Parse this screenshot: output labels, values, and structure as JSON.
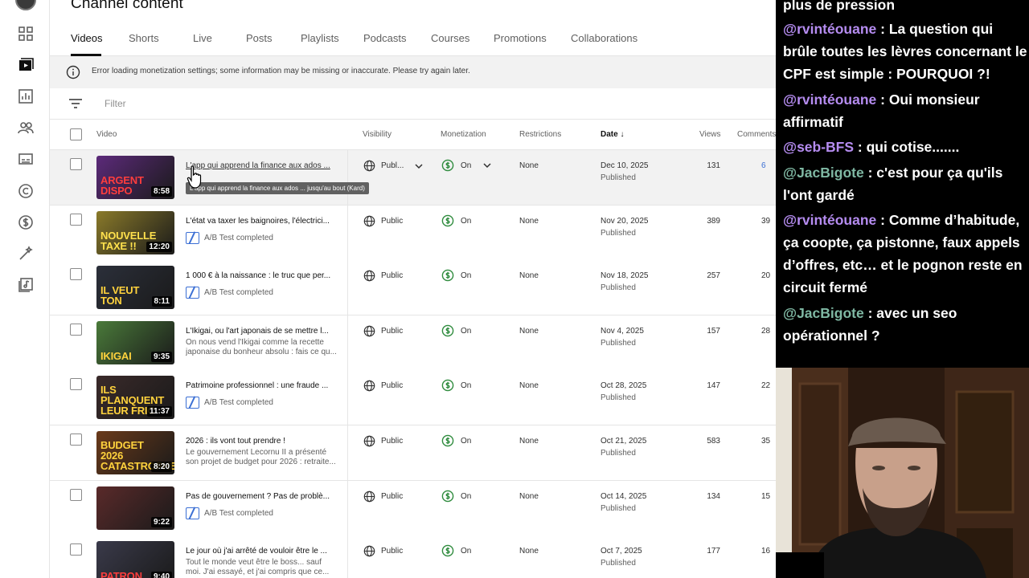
{
  "studio": {
    "page_title": "Channel content",
    "tabs": [
      "Videos",
      "Shorts",
      "Live",
      "Posts",
      "Playlists",
      "Podcasts",
      "Courses",
      "Promotions",
      "Collaborations"
    ],
    "active_tab": "Videos",
    "banner_text": "Error loading monetization settings; some information may be missing or inaccurate. Please try again later.",
    "filter_placeholder": "Filter",
    "columns": {
      "video": "Video",
      "visibility": "Visibility",
      "monetization": "Monetization",
      "restrictions": "Restrictions",
      "date": "Date",
      "views": "Views",
      "comments": "Comments"
    },
    "tooltip": "L'app qui apprend la finance aux ados ... jusqu'au bout (Kard)",
    "rows": [
      {
        "title": "L'app qui apprend la finance aux ados ...",
        "desc": "",
        "ab": "",
        "duration": "8:58",
        "thumb_text": "ARGENT DISPO",
        "thumb_bg": "#5c2a7a",
        "thumb_fg": "#ff3d3d",
        "visibility": "Publ...",
        "monetization": "On",
        "restrictions": "None",
        "date": "Dec 10, 2025",
        "status": "Published",
        "views": "131",
        "comments": "6"
      },
      {
        "title": "L'état va taxer les baignoires, l'électrici...",
        "desc": "",
        "ab": "A/B Test completed",
        "duration": "12:20",
        "thumb_text": "NOUVELLE TAXE !!",
        "thumb_bg": "#8a7a2a",
        "thumb_fg": "#ffe14d",
        "visibility": "Public",
        "monetization": "On",
        "restrictions": "None",
        "date": "Nov 20, 2025",
        "status": "Published",
        "views": "389",
        "comments": "39"
      },
      {
        "title": "1 000 € à la naissance : le truc que per...",
        "desc": "",
        "ab": "A/B Test completed",
        "duration": "8:11",
        "thumb_text": "IL VEUT TON",
        "thumb_bg": "#2b2f3a",
        "thumb_fg": "#ffd23d",
        "visibility": "Public",
        "monetization": "On",
        "restrictions": "None",
        "date": "Nov 18, 2025",
        "status": "Published",
        "views": "257",
        "comments": "20"
      },
      {
        "title": "L'Ikigai, ou l'art japonais de se mettre l...",
        "desc": "On nous vend l'Ikigai comme la recette japonaise du bonheur absolu : fais ce qu...",
        "ab": "",
        "duration": "9:35",
        "thumb_text": "IKIGAI",
        "thumb_bg": "#4a7a3a",
        "thumb_fg": "#ffd23d",
        "visibility": "Public",
        "monetization": "On",
        "restrictions": "None",
        "date": "Nov 4, 2025",
        "status": "Published",
        "views": "157",
        "comments": "28"
      },
      {
        "title": "Patrimoine professionnel : une fraude ...",
        "desc": "",
        "ab": "A/B Test completed",
        "duration": "11:37",
        "thumb_text": "ILS PLANQUENT LEUR FRIC",
        "thumb_bg": "#3a2a2a",
        "thumb_fg": "#ffd23d",
        "visibility": "Public",
        "monetization": "On",
        "restrictions": "None",
        "date": "Oct 28, 2025",
        "status": "Published",
        "views": "147",
        "comments": "22"
      },
      {
        "title": "2026 : ils vont tout prendre !",
        "desc": "Le gouvernement Lecornu II a présenté son projet de budget pour 2026 : retraite...",
        "ab": "",
        "duration": "8:20",
        "thumb_text": "BUDGET 2026 CATASTROPHE",
        "thumb_bg": "#6a3a1a",
        "thumb_fg": "#ffd23d",
        "visibility": "Public",
        "monetization": "On",
        "restrictions": "None",
        "date": "Oct 21, 2025",
        "status": "Published",
        "views": "583",
        "comments": "35"
      },
      {
        "title": "Pas de gouvernement ? Pas de problè...",
        "desc": "",
        "ab": "A/B Test completed",
        "duration": "9:22",
        "thumb_text": "",
        "thumb_bg": "#5a2a2a",
        "thumb_fg": "#ffd23d",
        "visibility": "Public",
        "monetization": "On",
        "restrictions": "None",
        "date": "Oct 14, 2025",
        "status": "Published",
        "views": "134",
        "comments": "15"
      },
      {
        "title": "Le jour où j'ai arrêté de vouloir être le ...",
        "desc": "Tout le monde veut être le boss... sauf moi. J'ai essayé, et j'ai compris que ce...",
        "ab": "",
        "duration": "9:40",
        "thumb_text": "PATRON",
        "thumb_bg": "#3a3a4a",
        "thumb_fg": "#ff3d3d",
        "visibility": "Public",
        "monetization": "On",
        "restrictions": "None",
        "date": "Oct 7, 2025",
        "status": "Published",
        "views": "177",
        "comments": "16"
      }
    ]
  },
  "chat": {
    "messages": [
      {
        "user": "",
        "text": "plus de pression",
        "color": "#ffffff"
      },
      {
        "user": "@rvintéouane",
        "text": " : La question qui brûle toutes les lèvres concernant le CPF est simple : POURQUOI ?!",
        "color": "#b58cf0"
      },
      {
        "user": "@rvintéouane",
        "text": " : Oui monsieur affirmatif",
        "color": "#b58cf0"
      },
      {
        "user": "@seb-BFS",
        "text": " : qui cotise.......",
        "color": "#b58cf0"
      },
      {
        "user": "@JacBigote",
        "text": " : c'est pour ça qu'ils l'ont gardé",
        "color": "#7fb8a3"
      },
      {
        "user": "@rvintéouane",
        "text": " : Comme d’habitude, ça coopte, ça pistonne, faux appels d’offres, etc… et le pognon reste en circuit fermé",
        "color": "#b58cf0"
      },
      {
        "user": "@JacBigote",
        "text": " : avec un seo opérationnel ?",
        "color": "#7fb8a3"
      }
    ]
  },
  "colors": {
    "accent_blue": "#3b6fd4",
    "monetization_green": "#2e8b3d",
    "chat_purple": "#b58cf0",
    "chat_teal": "#7fb8a3"
  }
}
